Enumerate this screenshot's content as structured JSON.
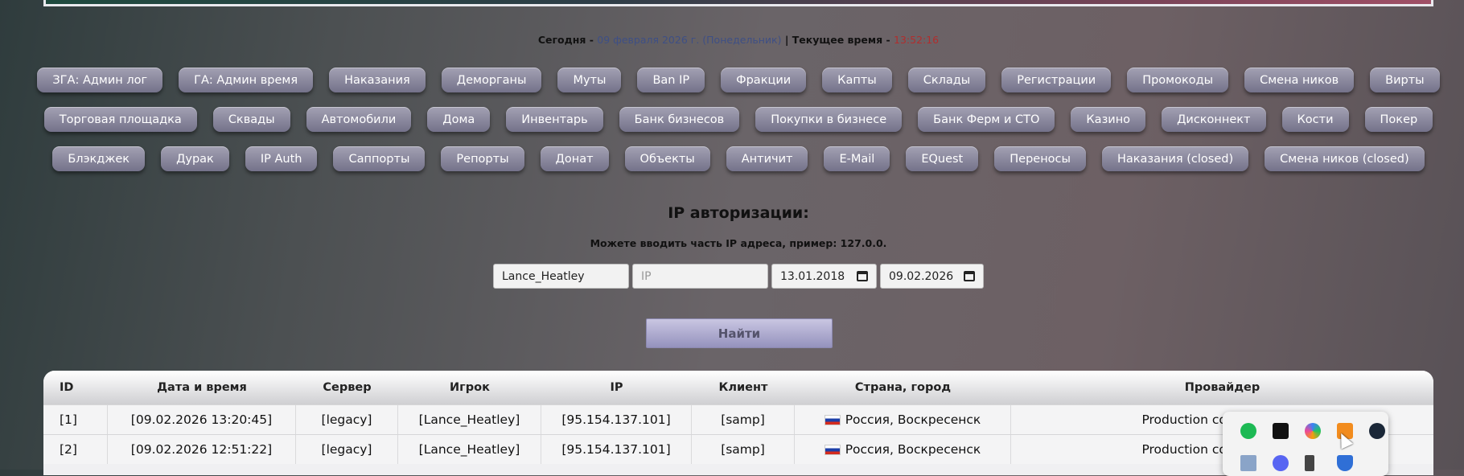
{
  "date_line": {
    "today_label": "Сегодня - ",
    "date": "09 февраля 2026 г. (Понедельник)",
    "separator": " | ",
    "time_label": "Текущее время - ",
    "time": "13:52:16"
  },
  "nav": {
    "row1": [
      "ЗГА: Админ лог",
      "ГА: Админ время",
      "Наказания",
      "Деморганы",
      "Муты",
      "Ban IP",
      "Фракции",
      "Капты",
      "Склады",
      "Регистрации",
      "Промокоды",
      "Смена ников",
      "Вирты"
    ],
    "row2": [
      "Торговая площадка",
      "Сквады",
      "Автомобили",
      "Дома",
      "Инвентарь",
      "Банк бизнесов",
      "Покупки в бизнесе",
      "Банк Ферм и СТО",
      "Казино",
      "Дисконнект",
      "Кости",
      "Покер"
    ],
    "row3": [
      "Блэкджек",
      "Дурак",
      "IP Auth",
      "Саппорты",
      "Репорты",
      "Донат",
      "Объекты",
      "Античит",
      "E-Mail",
      "EQuest",
      "Переносы",
      "Наказания (closed)",
      "Смена ников (closed)"
    ]
  },
  "search": {
    "title": "IP авторизации:",
    "hint": "Можете вводить часть IP адреса, пример: 127.0.0.",
    "player_value": "Lance_Heatley",
    "ip_placeholder": "IP",
    "date_from": "13.01.2018",
    "date_to": "09.02.2026",
    "submit_label": "Найти"
  },
  "table": {
    "columns": [
      "ID",
      "Дата и время",
      "Сервер",
      "Игрок",
      "IP",
      "Клиент",
      "Страна, город",
      "Провайдер"
    ],
    "rows": [
      [
        "[1]",
        "[09.02.2026 13:20:45]",
        "[legacy]",
        "[Lance_Heatley]",
        "[95.154.137.101]",
        "[samp]",
        "Россия, Воскресенск",
        "Production co-operative E"
      ],
      [
        "[2]",
        "[09.02.2026 12:51:22]",
        "[legacy]",
        "[Lance_Heatley]",
        "[95.154.137.101]",
        "[samp]",
        "Россия, Воскресенск",
        "Production co-operative E"
      ]
    ]
  },
  "tray": {
    "icons": [
      "spotify-icon",
      "nvidia-icon",
      "copilot-icon",
      "vlc-icon",
      "steam-icon",
      "notepad-icon",
      "discord-icon",
      "usb-icon",
      "shield-icon"
    ]
  }
}
